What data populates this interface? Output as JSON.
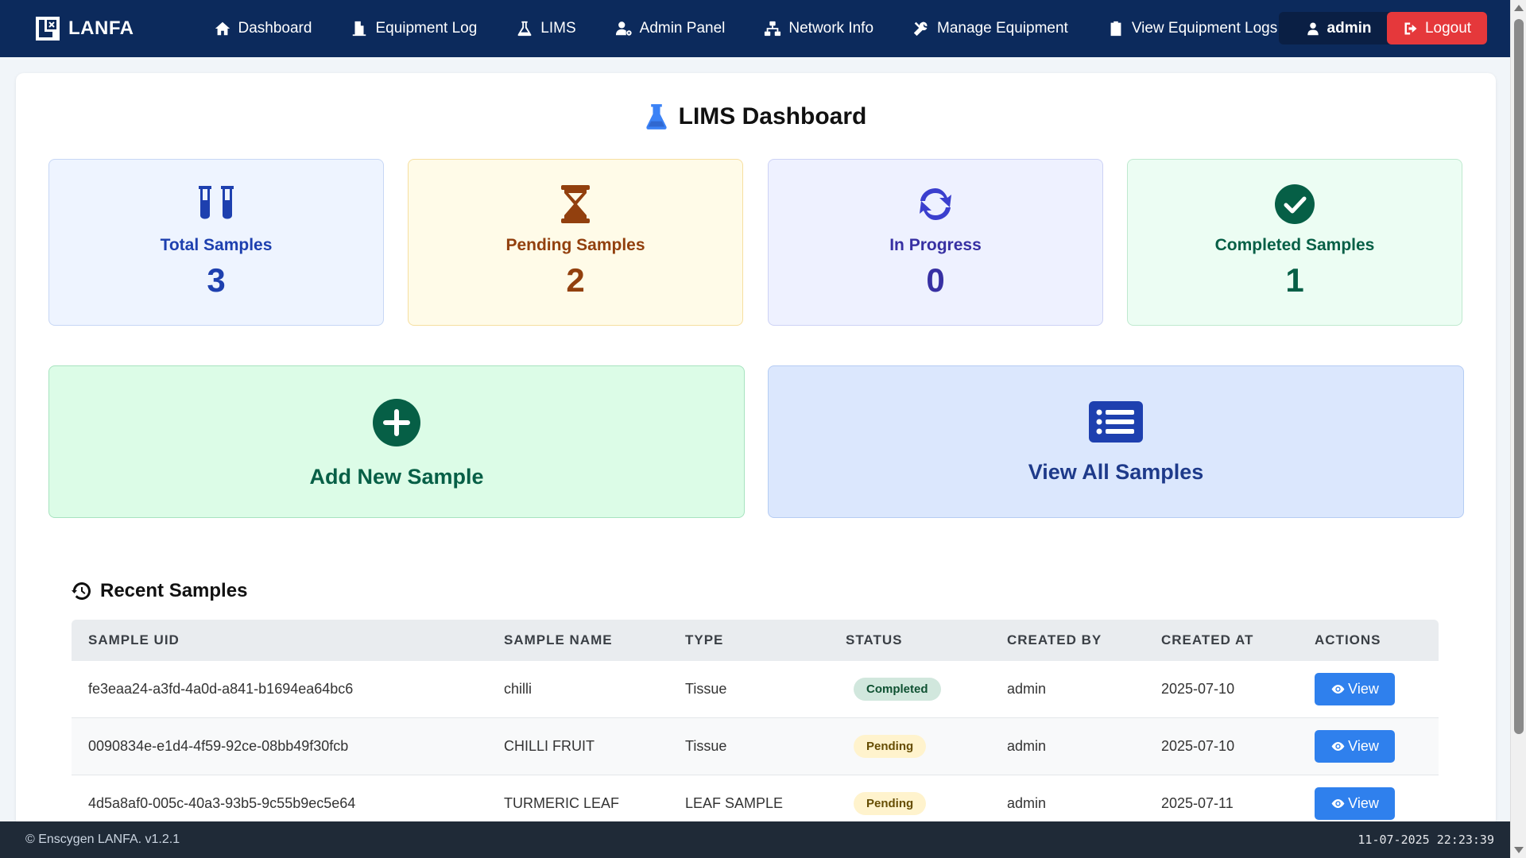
{
  "brand": {
    "name": "LANFA"
  },
  "nav": [
    {
      "label": "Dashboard",
      "icon": "home-icon"
    },
    {
      "label": "Equipment Log",
      "icon": "log-icon"
    },
    {
      "label": "LIMS",
      "icon": "flask-icon"
    },
    {
      "label": "Admin Panel",
      "icon": "user-gear-icon"
    },
    {
      "label": "Network Info",
      "icon": "network-icon"
    },
    {
      "label": "Manage Equipment",
      "icon": "tools-icon"
    },
    {
      "label": "View Equipment Logs",
      "icon": "clipboard-icon"
    }
  ],
  "user": {
    "name": "admin"
  },
  "logout": {
    "label": "Logout"
  },
  "page": {
    "title": "LIMS Dashboard"
  },
  "stats": [
    {
      "label": "Total Samples",
      "value": "3",
      "color": "#1e40af",
      "bg": "#eef4ff",
      "border": "#c7d7f5",
      "icon": "test-tubes-icon"
    },
    {
      "label": "Pending Samples",
      "value": "2",
      "color": "#92400e",
      "bg": "#fffbe8",
      "border": "#f6dfa0",
      "icon": "hourglass-icon"
    },
    {
      "label": "In Progress",
      "value": "0",
      "color": "#3730a3",
      "bg": "#eef1ff",
      "border": "#cdd2f5",
      "icon": "sync-icon"
    },
    {
      "label": "Completed Samples",
      "value": "1",
      "color": "#065f46",
      "bg": "#ecfdf3",
      "border": "#bfe9cf",
      "icon": "check-circle-icon"
    }
  ],
  "actions": {
    "add": {
      "label": "Add New Sample",
      "color": "#065f46",
      "bg": "#dcfce7",
      "icon": "plus-circle-icon"
    },
    "view_all": {
      "label": "View All Samples",
      "color": "#1e3a8a",
      "bg": "#dbe7fd",
      "icon": "list-icon"
    }
  },
  "recent": {
    "title": "Recent Samples",
    "columns": [
      "SAMPLE UID",
      "SAMPLE NAME",
      "TYPE",
      "STATUS",
      "CREATED BY",
      "CREATED AT",
      "ACTIONS"
    ],
    "rows": [
      {
        "uid": "fe3eaa24-a3fd-4a0d-a841-b1694ea64bc6",
        "name": "chilli",
        "type": "Tissue",
        "status": "Completed",
        "created_by": "admin",
        "created_at": "2025-07-10",
        "action": "View"
      },
      {
        "uid": "0090834e-e1d4-4f59-92ce-08bb49f30fcb",
        "name": "CHILLI FRUIT",
        "type": "Tissue",
        "status": "Pending",
        "created_by": "admin",
        "created_at": "2025-07-10",
        "action": "View"
      },
      {
        "uid": "4d5a8af0-005c-40a3-93b5-9c55b9ec5e64",
        "name": "TURMERIC LEAF",
        "type": "LEAF SAMPLE",
        "status": "Pending",
        "created_by": "admin",
        "created_at": "2025-07-11",
        "action": "View"
      }
    ]
  },
  "footer": {
    "copyright": "© Enscygen LANFA. v1.2.1",
    "datetime": "11-07-2025 22:23:39"
  }
}
